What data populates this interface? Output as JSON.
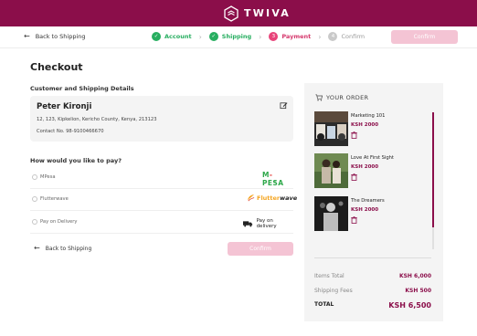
{
  "brand": {
    "name": "TWIVA",
    "color": "#8b0e4a"
  },
  "header": {
    "back_label": "Back to Shipping",
    "steps": [
      {
        "number": "1",
        "label": "Account",
        "state": "done"
      },
      {
        "number": "2",
        "label": "Shipping",
        "state": "done"
      },
      {
        "number": "3",
        "label": "Payment",
        "state": "active"
      },
      {
        "number": "4",
        "label": "Confirm",
        "state": "idle"
      }
    ],
    "confirm_label": "Confirm"
  },
  "checkout": {
    "title": "Checkout",
    "section_title": "Customer and Shipping Details",
    "address": {
      "name": "Peter Kironji",
      "line": "12, 123, Kipkelion, Kericho County, Kenya, 213123",
      "contact": "Contact No. 98-9100466670"
    },
    "payment_title": "How would you like to pay?",
    "payment_options": [
      {
        "label": "MPesa",
        "brand": "M-PESA"
      },
      {
        "label": "Flutterwave",
        "brand": "Flutterwave"
      },
      {
        "label": "Pay on Delivery",
        "brand": "Pay on delivery"
      }
    ],
    "back_label": "Back to Shipping",
    "confirm_label": "Confirm"
  },
  "order": {
    "heading": "YOUR ORDER",
    "items": [
      {
        "title": "Marketing 101",
        "price": "KSH 2000"
      },
      {
        "title": "Love At First Sight",
        "price": "KSH 2000"
      },
      {
        "title": "The Dreamers",
        "price": "KSH 2000"
      }
    ],
    "totals": {
      "items_label": "Items Total",
      "items_value": "KSH 6,000",
      "shipping_label": "Shipping Fees",
      "shipping_value": "KSH 500",
      "total_label": "TOTAL",
      "total_value": "KSH 6,500"
    }
  }
}
